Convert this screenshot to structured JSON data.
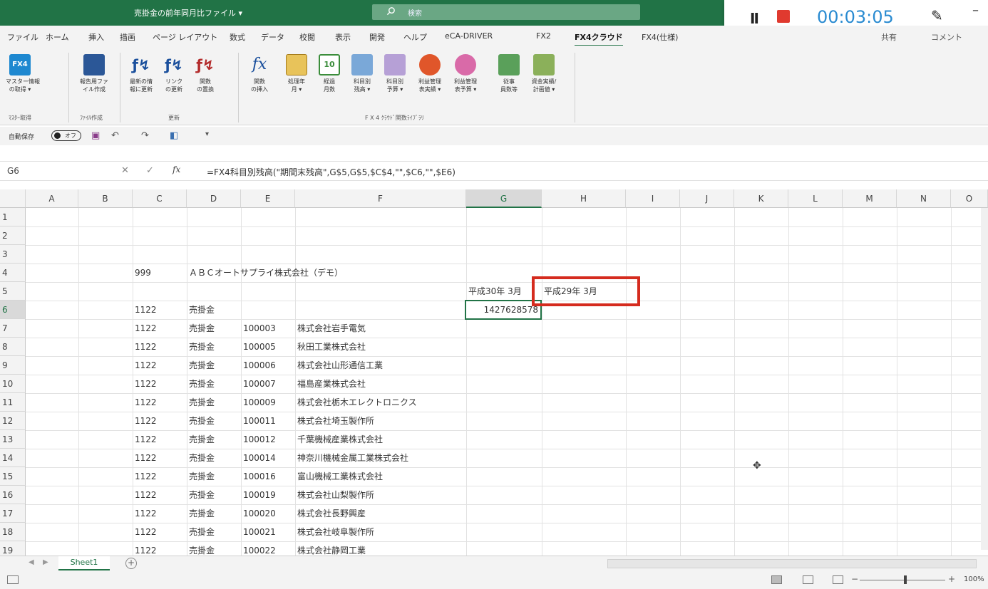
{
  "titlebar": {
    "title": "売掛金の前年同月比ファイル ▾",
    "search_placeholder": "検索"
  },
  "recorder": {
    "pause": "II",
    "time": "00:03:05",
    "pen": "✎",
    "dash": "–"
  },
  "tabs": [
    "ファイル",
    "ホーム",
    "挿入",
    "描画",
    "ページ レイアウト",
    "数式",
    "データ",
    "校閲",
    "表示",
    "開発",
    "ヘルプ",
    "eCA-DRIVER",
    "FX2",
    "FX4クラウド",
    "FX4(仕様)"
  ],
  "tabs_right": [
    "共有",
    "コメント"
  ],
  "ribbon": {
    "buttons": [
      {
        "label1": "マスター情報",
        "label2": "の取得 ▾"
      },
      {
        "label1": "報告用ファ",
        "label2": "イル作成"
      },
      {
        "label1": "最新の情",
        "label2": "報に更新"
      },
      {
        "label1": "リンク",
        "label2": "の更新"
      },
      {
        "label1": "関数",
        "label2": "の置換"
      },
      {
        "label1": "関数",
        "label2": "の挿入"
      },
      {
        "label1": "処理年",
        "label2": "月 ▾"
      },
      {
        "label1": "経過",
        "label2": "月数"
      },
      {
        "label1": "科目別",
        "label2": "残高 ▾"
      },
      {
        "label1": "科目別",
        "label2": "予算 ▾"
      },
      {
        "label1": "利益管理",
        "label2": "表実績 ▾"
      },
      {
        "label1": "利益管理",
        "label2": "表予算 ▾"
      },
      {
        "label1": "従事",
        "label2": "員数等"
      },
      {
        "label1": "資金実績/",
        "label2": "計画値 ▾"
      }
    ],
    "groups": [
      "ﾏｽﾀｰ取得",
      "ﾌｧｲﾙ作成",
      "更新",
      "F X 4 ｸﾗｳﾄﾞ関数ﾗｲﾌﾞﾗﾘ"
    ]
  },
  "qat": {
    "autosave_label": "自動保存",
    "toggle_label": "オフ"
  },
  "formula_bar": {
    "name_box": "G6",
    "fx": "fx",
    "formula": "=FX4科目別残高(\"期間末残高\",G$5,G$5,$C$4,\"\",$C6,\"\",$E6)"
  },
  "columns": [
    "A",
    "B",
    "C",
    "D",
    "E",
    "F",
    "G",
    "H",
    "I",
    "J",
    "K",
    "L",
    "M",
    "N",
    "O"
  ],
  "rows": [
    "1",
    "2",
    "3",
    "4",
    "5",
    "6",
    "7",
    "8",
    "9",
    "10",
    "11",
    "12",
    "13",
    "14",
    "15",
    "16",
    "17",
    "18",
    "19"
  ],
  "cells": {
    "c4": "999",
    "d4": "ＡＢＣオートサプライ株式会社（デモ）",
    "g5": "平成30年 3月",
    "h5": "平成29年 3月",
    "c6": "1122",
    "d6": "売掛金",
    "g6": "1427628578"
  },
  "data_rows": [
    {
      "code": "1122",
      "account": "売掛金",
      "id": "100003",
      "name": "株式会社岩手電気"
    },
    {
      "code": "1122",
      "account": "売掛金",
      "id": "100005",
      "name": "秋田工業株式会社"
    },
    {
      "code": "1122",
      "account": "売掛金",
      "id": "100006",
      "name": "株式会社山形通信工業"
    },
    {
      "code": "1122",
      "account": "売掛金",
      "id": "100007",
      "name": "福島産業株式会社"
    },
    {
      "code": "1122",
      "account": "売掛金",
      "id": "100009",
      "name": "株式会社栃木エレクトロニクス"
    },
    {
      "code": "1122",
      "account": "売掛金",
      "id": "100011",
      "name": "株式会社埼玉製作所"
    },
    {
      "code": "1122",
      "account": "売掛金",
      "id": "100012",
      "name": "千葉機械産業株式会社"
    },
    {
      "code": "1122",
      "account": "売掛金",
      "id": "100014",
      "name": "神奈川機械金属工業株式会社"
    },
    {
      "code": "1122",
      "account": "売掛金",
      "id": "100016",
      "name": "富山機械工業株式会社"
    },
    {
      "code": "1122",
      "account": "売掛金",
      "id": "100019",
      "name": "株式会社山梨製作所"
    },
    {
      "code": "1122",
      "account": "売掛金",
      "id": "100020",
      "name": "株式会社長野興産"
    },
    {
      "code": "1122",
      "account": "売掛金",
      "id": "100021",
      "name": "株式会社岐阜製作所"
    },
    {
      "code": "1122",
      "account": "売掛金",
      "id": "100022",
      "name": "株式会社静岡工業"
    }
  ],
  "sheet_tab": "Sheet1",
  "zoom": "100%",
  "colors": {
    "excel_green": "#217346",
    "highlight_red": "#d52b1e",
    "timer_blue": "#2a8bd1"
  }
}
